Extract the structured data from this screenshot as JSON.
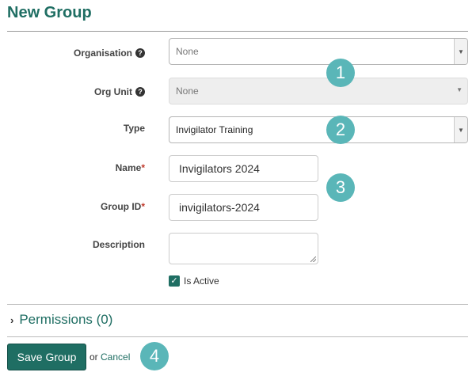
{
  "page": {
    "title": "New Group"
  },
  "form": {
    "organisation": {
      "label": "Organisation",
      "value": "None"
    },
    "org_unit": {
      "label": "Org Unit",
      "value": "None"
    },
    "type": {
      "label": "Type",
      "value": "Invigilator Training"
    },
    "name": {
      "label": "Name",
      "required_mark": "*",
      "value": "Invigilators 2024"
    },
    "group_id": {
      "label": "Group ID",
      "required_mark": "*",
      "value": "invigilators-2024"
    },
    "description": {
      "label": "Description",
      "value": ""
    },
    "is_active": {
      "label": "Is Active",
      "checked": true
    }
  },
  "permissions": {
    "label": "Permissions (0)"
  },
  "actions": {
    "save_label": "Save Group",
    "or_text": "or",
    "cancel_label": "Cancel"
  },
  "callouts": [
    "1",
    "2",
    "3",
    "4"
  ],
  "icons": {
    "help": "?",
    "dropdown": "▼",
    "chevron": "›",
    "check": "✓"
  },
  "colors": {
    "accent": "#1f6e63",
    "callout": "#5ab6b8",
    "required": "#c0392b"
  }
}
